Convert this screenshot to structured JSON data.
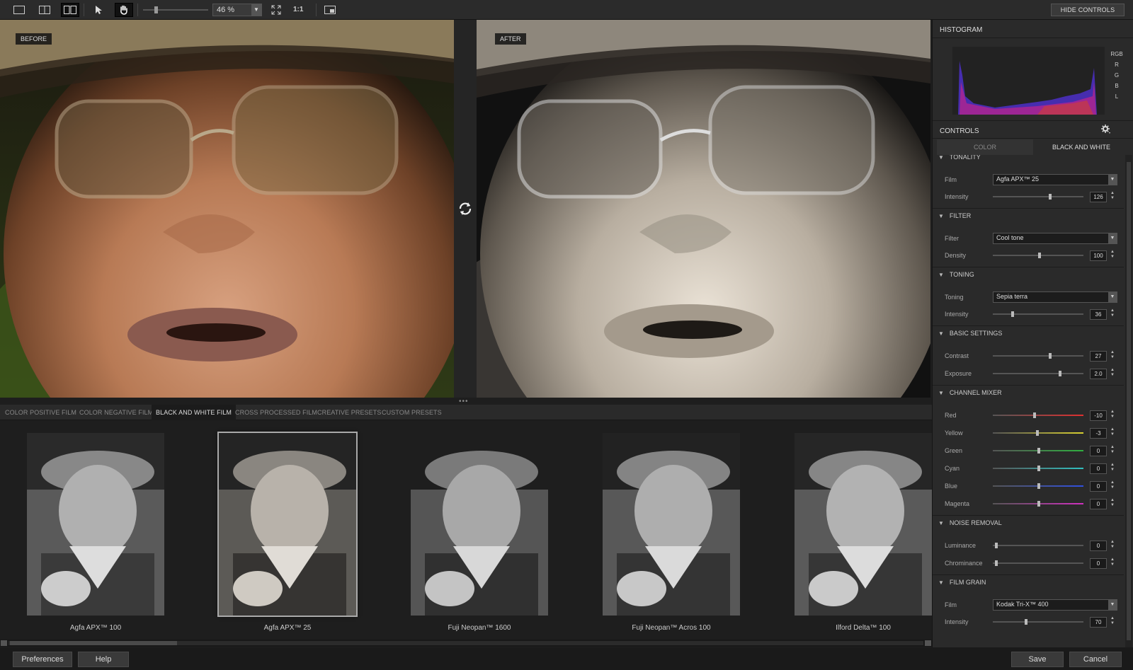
{
  "toolbar": {
    "zoom_value": "46 %",
    "one_to_one": "1:1",
    "hide_controls": "HIDE CONTROLS"
  },
  "panes": {
    "before_label": "BEFORE",
    "after_label": "AFTER"
  },
  "film_tabs": [
    "COLOR POSITIVE FILM",
    "COLOR NEGATIVE FILM",
    "BLACK AND WHITE FILM",
    "CROSS PROCESSED FILM",
    "CREATIVE PRESETS",
    "CUSTOM PRESETS"
  ],
  "thumbnails": [
    "Agfa APX™ 100",
    "Agfa APX™ 25",
    "Fuji Neopan™ 1600",
    "Fuji Neopan™ Acros 100",
    "Ilford Delta™ 100"
  ],
  "bottom": {
    "preferences": "Preferences",
    "help": "Help",
    "save": "Save",
    "cancel": "Cancel"
  },
  "panel": {
    "histogram_title": "HISTOGRAM",
    "channels": [
      "RGB",
      "R",
      "G",
      "B",
      "L"
    ],
    "controls_title": "CONTROLS",
    "mode_tabs": [
      "COLOR",
      "BLACK AND WHITE"
    ],
    "sections": {
      "tonality": {
        "title": "TONALITY",
        "film_label": "Film",
        "film_value": "Agfa APX™ 25",
        "intensity_label": "Intensity",
        "intensity_value": "126"
      },
      "filter": {
        "title": "FILTER",
        "filter_label": "Filter",
        "filter_value": "Cool tone",
        "density_label": "Density",
        "density_value": "100"
      },
      "toning": {
        "title": "TONING",
        "toning_label": "Toning",
        "toning_value": "Sepia terra",
        "intensity_label": "Intensity",
        "intensity_value": "36"
      },
      "basic": {
        "title": "BASIC SETTINGS",
        "contrast_label": "Contrast",
        "contrast_value": "27",
        "exposure_label": "Exposure",
        "exposure_value": "2.0"
      },
      "mixer": {
        "title": "CHANNEL MIXER",
        "rows": [
          {
            "label": "Red",
            "value": "-10"
          },
          {
            "label": "Yellow",
            "value": "-3"
          },
          {
            "label": "Green",
            "value": "0"
          },
          {
            "label": "Cyan",
            "value": "0"
          },
          {
            "label": "Blue",
            "value": "0"
          },
          {
            "label": "Magenta",
            "value": "0"
          }
        ]
      },
      "noise": {
        "title": "NOISE REMOVAL",
        "luminance_label": "Luminance",
        "luminance_value": "0",
        "chrominance_label": "Chrominance",
        "chrominance_value": "0"
      },
      "grain": {
        "title": "FILM GRAIN",
        "film_label": "Film",
        "film_value": "Kodak Tri-X™ 400",
        "intensity_label": "Intensity",
        "intensity_value": "70"
      }
    }
  }
}
